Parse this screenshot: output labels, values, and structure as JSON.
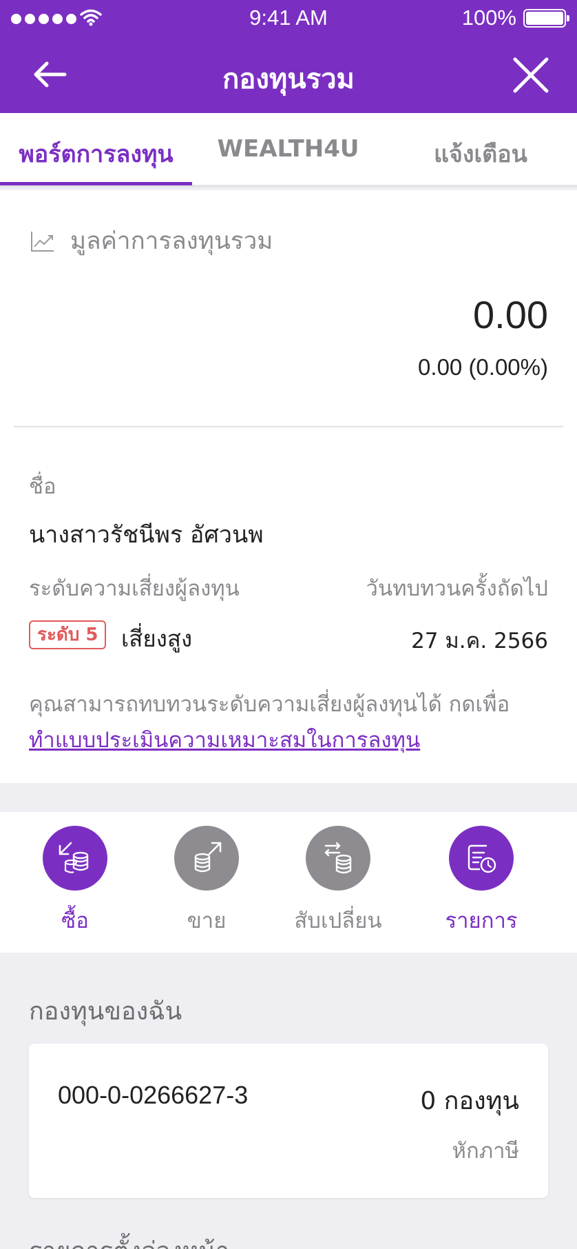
{
  "status_bar": {
    "time": "9:41 AM",
    "battery": "100%"
  },
  "header": {
    "title": "กองทุนรวม"
  },
  "tabs": [
    {
      "label": "พอร์ตการลงทุน"
    },
    {
      "label": "WEALTH4U"
    },
    {
      "label": "แจ้งเตือน"
    }
  ],
  "summary": {
    "market_value_label": "มูลค่าการลงทุนรวม",
    "market_value": "0.00",
    "change": "0.00 (0.00%)"
  },
  "profile": {
    "name_label": "ชื่อ",
    "name": "นางสาวรัชนีพร อัศวนพ",
    "risk_label": "ระดับความเสี่ยงผู้ลงทุน",
    "review_label": "วันทบทวนครั้งถัดไป",
    "risk_badge": "ระดับ 5",
    "risk_text": "เสี่ยงสูง",
    "review_date": "27 ม.ค. 2566",
    "note": "คุณสามารถทบทวนระดับความเสี่ยงผู้ลงทุนได้ กดเพื่อ",
    "link": "ทำแบบประเมินความเหมาะสมในการลงทุน"
  },
  "actions": [
    {
      "label": "ซื้อ",
      "icon": "buy-icon",
      "color": "#7b2fc2"
    },
    {
      "label": "ขาย",
      "icon": "sell-icon",
      "color": "#8e8c91"
    },
    {
      "label": "สับเปลี่ยน",
      "icon": "switch-icon",
      "color": "#8e8c91"
    },
    {
      "label": "รายการ",
      "icon": "transactions-icon",
      "color": "#7b2fc2"
    }
  ],
  "my_funds": {
    "title": "กองทุนของฉัน",
    "account_number": "000-0-0266627-3",
    "fund_count": "0 กองทุน",
    "tax_label": "หักภาษี"
  },
  "preset": {
    "title": "รายการตั้งล่วงหน้า"
  },
  "colors": {
    "brand": "#7b2fc2",
    "risk": "#e05b5b"
  }
}
